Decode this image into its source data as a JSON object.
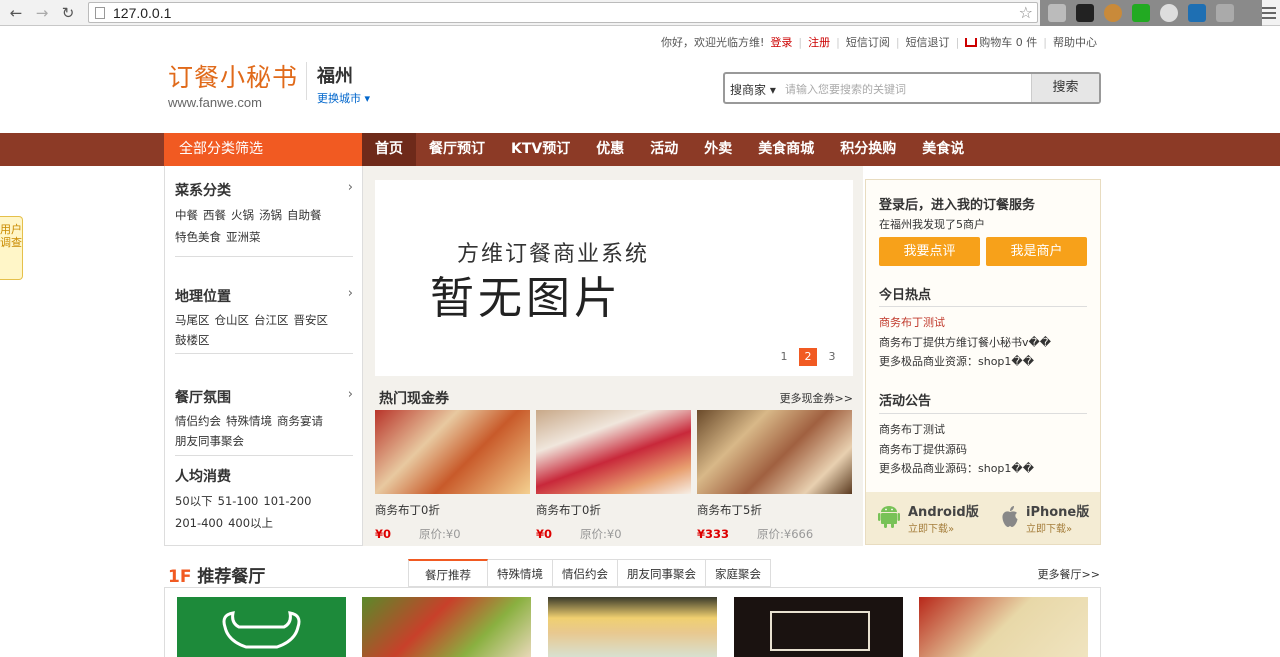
{
  "browser": {
    "url": "127.0.0.1"
  },
  "toplinks": {
    "greeting": "你好，欢迎光临方维!",
    "login": "登录",
    "register": "注册",
    "sms_subscribe": "短信订阅",
    "sms_unsubscribe": "短信退订",
    "cart": "购物车 0 件",
    "help": "帮助中心"
  },
  "header": {
    "logo_cn": "订餐小秘书",
    "logo_en": "www.fanwe.com",
    "city": "福州",
    "switch_city": "更换城市"
  },
  "search": {
    "type": "搜商家",
    "placeholder": "请输入您要搜索的关键词",
    "button": "搜索"
  },
  "nav": {
    "all_categories": "全部分类筛选",
    "items": [
      "首页",
      "餐厅预订",
      "KTV预订",
      "优惠",
      "活动",
      "外卖",
      "美食商城",
      "积分换购",
      "美食说"
    ]
  },
  "survey": "用户调查",
  "sidebar": {
    "cuisine": {
      "title": "菜系分类",
      "links": [
        "中餐",
        "西餐",
        "火锅",
        "汤锅",
        "自助餐",
        "特色美食",
        "亚洲菜"
      ]
    },
    "location": {
      "title": "地理位置",
      "links": [
        "马尾区",
        "仓山区",
        "台江区",
        "晋安区",
        "鼓楼区"
      ]
    },
    "ambience": {
      "title": "餐厅氛围",
      "links": [
        "情侣约会",
        "特殊情境",
        "商务宴请",
        "朋友同事聚会"
      ]
    },
    "price": {
      "title": "人均消费",
      "links": [
        "50以下",
        "51-100",
        "101-200",
        "201-400",
        "400以上"
      ]
    }
  },
  "banner": {
    "line1": "方维订餐商业系统",
    "line2": "暂无图片",
    "pages": [
      "1",
      "2",
      "3"
    ],
    "current_page": "2"
  },
  "coupons": {
    "title": "热门现金券",
    "more": "更多现金券>>",
    "items": [
      {
        "name": "商务布丁0折",
        "price": "¥0",
        "original": "原价:¥0"
      },
      {
        "name": "商务布丁0折",
        "price": "¥0",
        "original": "原价:¥0"
      },
      {
        "name": "商务布丁5折",
        "price": "¥333",
        "original": "原价:¥666"
      }
    ]
  },
  "right": {
    "login_title": "登录后，进入我的订餐服务",
    "found_text": "在福州我发现了5商户",
    "btn_review": "我要点评",
    "btn_merchant": "我是商户",
    "hot_title": "今日热点",
    "hot_items": [
      "商务布丁测试",
      "商务布丁提供方维订餐小秘书v��",
      "更多极品商业资源：shop1��"
    ],
    "notice_title": "活动公告",
    "notice_items": [
      "商务布丁测试",
      "商务布丁提供源码",
      "更多极品商业源码：shop1��"
    ],
    "android": {
      "name": "Android版",
      "download": "立即下载»"
    },
    "iphone": {
      "name": "iPhone版",
      "download": "立即下载»"
    }
  },
  "floor": {
    "num": "1F",
    "title": "推荐餐厅",
    "tabs": [
      "餐厅推荐",
      "特殊情境",
      "情侣约会",
      "朋友同事聚会",
      "家庭聚会"
    ],
    "more": "更多餐厅>>"
  }
}
